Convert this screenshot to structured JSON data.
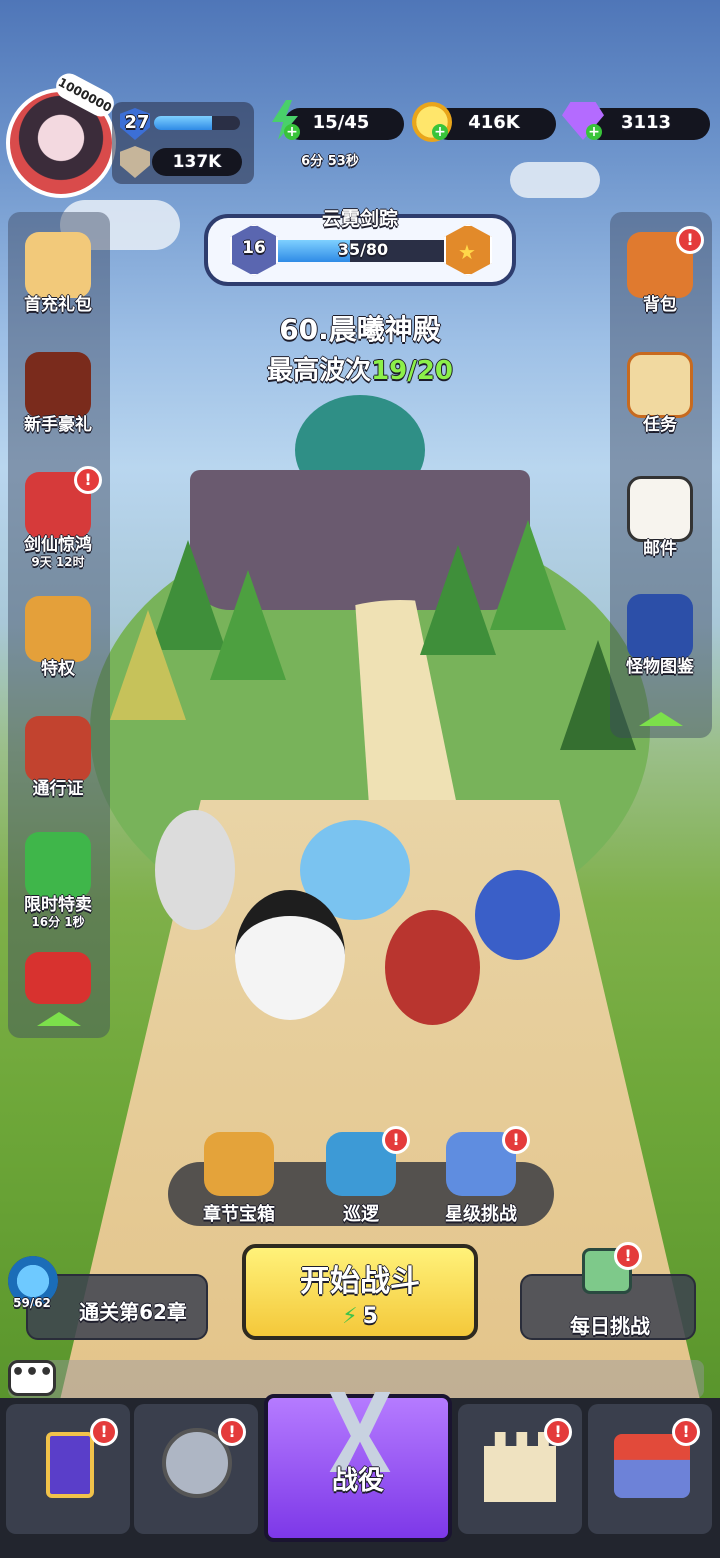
{
  "player": {
    "avatar_badge": "1000000",
    "level": "27",
    "level_progress": 0.68,
    "power": "137K"
  },
  "resources": {
    "energy": "15/45",
    "energy_timer": "6分 53秒",
    "gold": "416K",
    "gems": "3113"
  },
  "chapter": {
    "title": "云霓剑踪",
    "level": "16",
    "progress": "35/80",
    "progress_fraction": 0.4375
  },
  "stage": {
    "name": "60.晨曦神殿",
    "wave_prefix": "最高波次",
    "wave_value": "19/20"
  },
  "left_menu": [
    {
      "label": "首充礼包",
      "sub": "",
      "alert": false
    },
    {
      "label": "新手豪礼",
      "sub": "",
      "alert": false
    },
    {
      "label": "剑仙惊鸿",
      "sub": "9天 12时",
      "alert": true
    },
    {
      "label": "特权",
      "sub": "",
      "alert": false
    },
    {
      "label": "通行证",
      "sub": "",
      "alert": false
    },
    {
      "label": "限时特卖",
      "sub": "16分 1秒",
      "alert": false
    },
    {
      "label": "",
      "sub": "",
      "alert": false
    }
  ],
  "right_menu": [
    {
      "label": "背包",
      "alert": true
    },
    {
      "label": "任务",
      "alert": false
    },
    {
      "label": "邮件",
      "alert": false
    },
    {
      "label": "怪物图鉴",
      "alert": false
    }
  ],
  "actions": [
    {
      "label": "章节宝箱",
      "alert": false
    },
    {
      "label": "巡逻",
      "alert": true
    },
    {
      "label": "星级挑战",
      "alert": true
    }
  ],
  "start": {
    "label": "开始战斗",
    "cost": "5"
  },
  "chapter_clear": {
    "gauge": "59/62",
    "label": "通关第62章"
  },
  "daily": {
    "label": "每日挑战",
    "alert": true
  },
  "chat": {
    "icon_text": "•••"
  },
  "nav": [
    {
      "label": "",
      "alert": true
    },
    {
      "label": "",
      "alert": true
    },
    {
      "label": "战役",
      "alert": false
    },
    {
      "label": "",
      "alert": true
    },
    {
      "label": "",
      "alert": true
    }
  ],
  "alert_glyph": "!",
  "colors": {
    "accent_purple": "#8b44f0",
    "start_yellow": "#f7d94a",
    "alert_red": "#e43b3b",
    "energy_green": "#39c43a",
    "wave_green": "#8cf04a"
  }
}
